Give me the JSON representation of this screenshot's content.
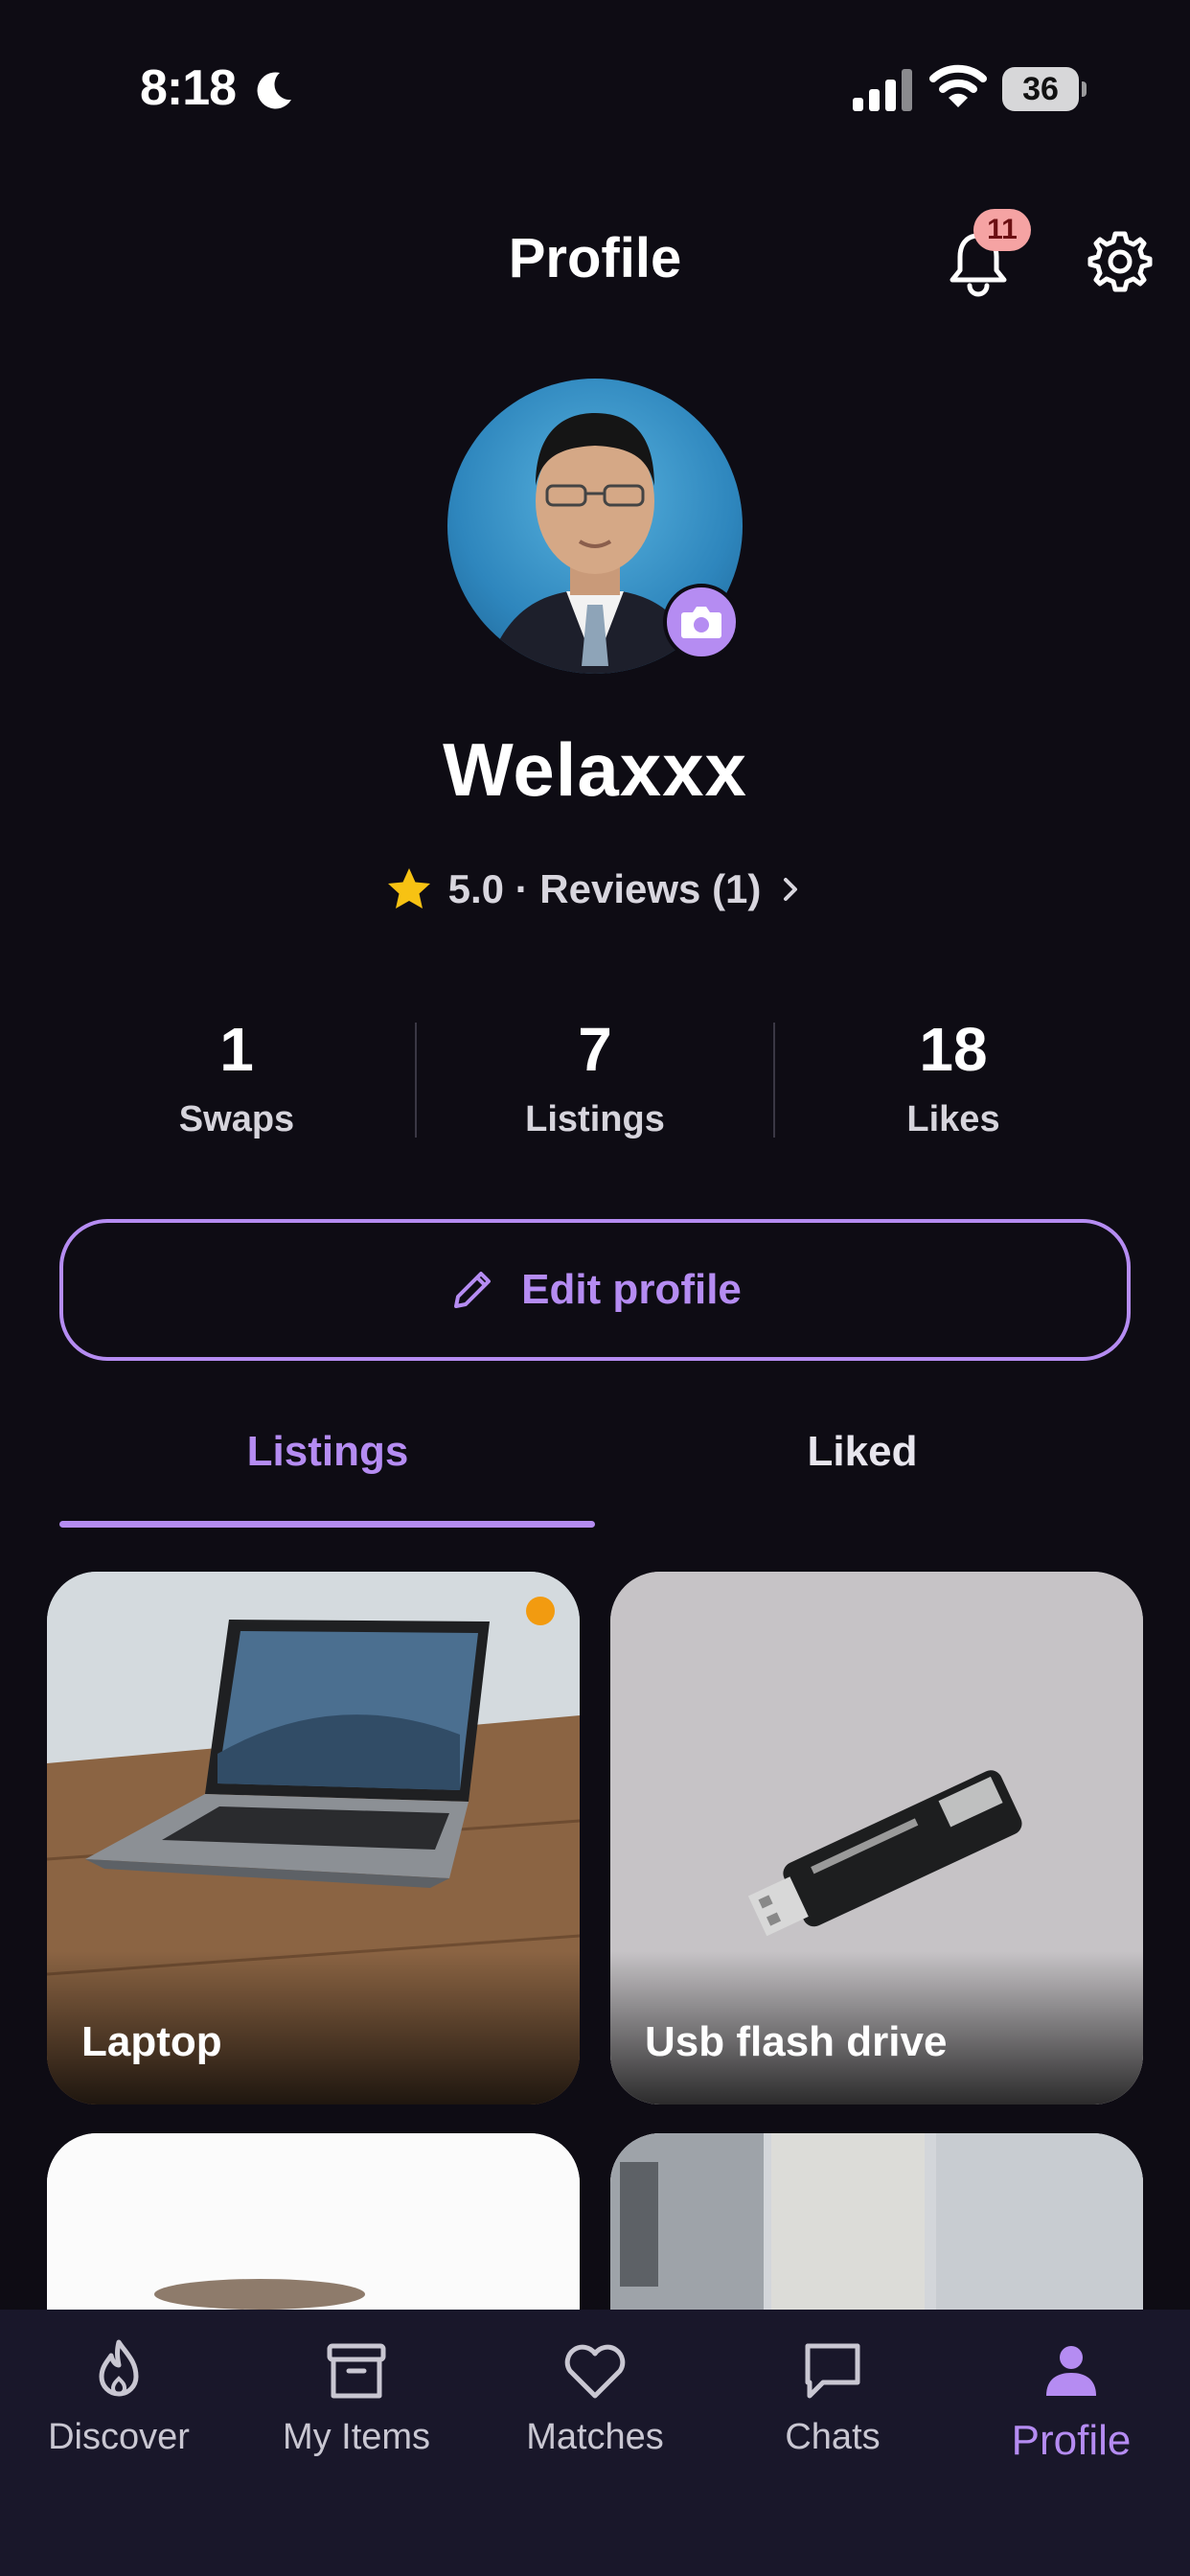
{
  "status_bar": {
    "time": "8:18",
    "battery": "36"
  },
  "header": {
    "title": "Profile",
    "notification_count": "11"
  },
  "profile": {
    "name": "Welaxxx",
    "rating": "5.0 · Reviews (1)"
  },
  "stats": [
    {
      "value": "1",
      "label": "Swaps"
    },
    {
      "value": "7",
      "label": "Listings"
    },
    {
      "value": "18",
      "label": "Likes"
    }
  ],
  "edit_button": {
    "label": "Edit profile"
  },
  "tabs": [
    {
      "label": "Listings",
      "active": true
    },
    {
      "label": "Liked",
      "active": false
    }
  ],
  "listings": [
    {
      "title": "Laptop"
    },
    {
      "title": "Usb flash drive"
    }
  ],
  "bottom_nav": [
    {
      "label": "Discover",
      "icon": "flame-icon"
    },
    {
      "label": "My Items",
      "icon": "archive-box-icon"
    },
    {
      "label": "Matches",
      "icon": "heart-icon"
    },
    {
      "label": "Chats",
      "icon": "chat-bubble-icon"
    },
    {
      "label": "Profile",
      "icon": "person-icon",
      "active": true
    }
  ],
  "colors": {
    "accent": "#b58cf2",
    "background": "#0e0c14",
    "tab_bar": "#19172a",
    "badge": "#f5a3a3",
    "star": "#f7c213",
    "status_dot": "#f29b10"
  }
}
